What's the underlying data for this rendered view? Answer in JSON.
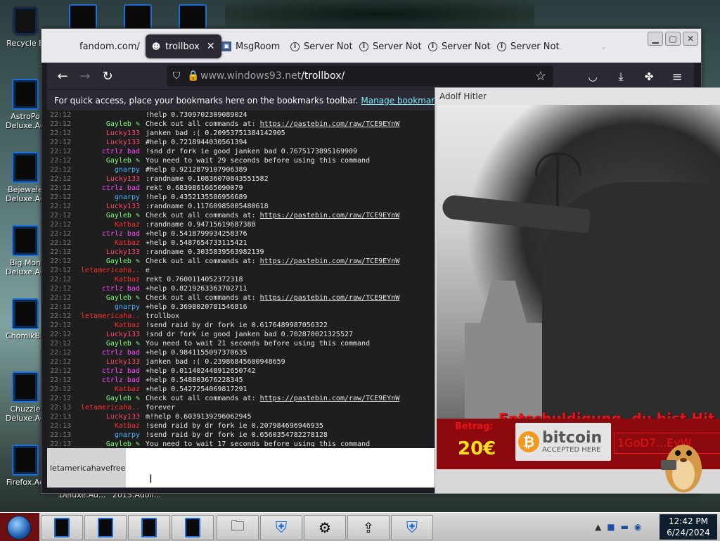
{
  "desktop": {
    "icons": [
      {
        "label": "Recycle B",
        "name": "recycle-bin"
      },
      {
        "label": "AstroPo Deluxe.Ad",
        "name": "astropo"
      },
      {
        "label": "Bejewele Deluxe.Ad",
        "name": "bejeweled"
      },
      {
        "label": "Big Mon Deluxe.Ad",
        "name": "bigmon"
      },
      {
        "label": "ChomikBo",
        "name": "chomikbo"
      },
      {
        "label": "Chuzzle Deluxe.Ad",
        "name": "chuzzle"
      },
      {
        "label": "Firefox.Ad",
        "name": "firefox"
      }
    ],
    "bottom_labels": [
      "Deluxe.Ad...",
      "2015.Adolf..."
    ]
  },
  "browser": {
    "tabs": [
      {
        "label": "fandom.com/",
        "icon": "none",
        "active": false
      },
      {
        "label": "trollbox",
        "icon": "troll-icon",
        "active": true
      },
      {
        "label": "MsgRoom",
        "icon": "msgroom-icon",
        "active": false
      },
      {
        "label": "Server Not",
        "icon": "info-icon",
        "active": false
      },
      {
        "label": "Server Not",
        "icon": "info-icon",
        "active": false
      },
      {
        "label": "Server Not",
        "icon": "info-icon",
        "active": false
      },
      {
        "label": "Server Not",
        "icon": "info-icon",
        "active": false
      }
    ],
    "url_host": "www.windows93.net",
    "url_path": "/trollbox/",
    "bookmarks_text": "For quick access, place your bookmarks here on the bookmarks toolbar.",
    "bookmarks_link": "Manage bookmarks..."
  },
  "chat": {
    "rows": [
      {
        "t": "22:12",
        "n": "",
        "c": "#ff6fd0",
        "m": "!help 0.7309702309089024"
      },
      {
        "t": "22:12",
        "n": "Gayleb ✎",
        "c": "#7cff7c",
        "m": "Check out all commands at: ",
        "link": "https://pastebin.com/raw/TCE9EYnW"
      },
      {
        "t": "22:12",
        "n": "Lucky133",
        "c": "#ff4a6a",
        "m": "janken bad :( 0.20953751384142905"
      },
      {
        "t": "22:12",
        "n": "Lucky133",
        "c": "#ff4a6a",
        "m": "#help 0.7218944030561394"
      },
      {
        "t": "22:12",
        "n": "ctrlz bad",
        "c": "#ff4aff",
        "m": "!snd dr fork ie good janken bad 0.7675173895169909"
      },
      {
        "t": "22:12",
        "n": "Gayleb ✎",
        "c": "#7cff7c",
        "m": "You need to wait 29 seconds before using this command"
      },
      {
        "t": "22:12",
        "n": "gnarpy",
        "c": "#4ab0ff",
        "m": "#help 0.9212879107906389"
      },
      {
        "t": "22:12",
        "n": "Lucky133",
        "c": "#ff4a6a",
        "m": ":randname 0.10836070843551582"
      },
      {
        "t": "22:12",
        "n": "ctrlz bad",
        "c": "#ff4aff",
        "m": "rekt 0.6839861665090079"
      },
      {
        "t": "22:12",
        "n": "gnarpy",
        "c": "#4ab0ff",
        "m": "!help 0.4352135586956689"
      },
      {
        "t": "22:12",
        "n": "Lucky133",
        "c": "#ff4a6a",
        "m": ":randname 0.11760985005480618"
      },
      {
        "t": "22:12",
        "n": "Gayleb ✎",
        "c": "#7cff7c",
        "m": "Check out all commands at: ",
        "link": "https://pastebin.com/raw/TCE9EYnW"
      },
      {
        "t": "22:12",
        "n": "Katbaz",
        "c": "#ff3030",
        "m": ":randname 0.94715619687388"
      },
      {
        "t": "22:12",
        "n": "ctrlz bad",
        "c": "#ff4aff",
        "m": "+help 0.5418799934258376"
      },
      {
        "t": "22:12",
        "n": "Katbaz",
        "c": "#ff3030",
        "m": "+help 0.5487654733115421"
      },
      {
        "t": "22:12",
        "n": "Lucky133",
        "c": "#ff4a6a",
        "m": ":randname 0.3035839563982139"
      },
      {
        "t": "22:12",
        "n": "Gayleb ✎",
        "c": "#7cff7c",
        "m": "Check out all commands at: ",
        "link": "https://pastebin.com/raw/TCE9EYnW"
      },
      {
        "t": "22:12",
        "n": "letamericaha..",
        "c": "#ff3030",
        "m": "e"
      },
      {
        "t": "22:12",
        "n": "Katbaz",
        "c": "#ff3030",
        "m": "rekt 0.7600114052372318"
      },
      {
        "t": "22:12",
        "n": "ctrlz bad",
        "c": "#ff4aff",
        "m": "+help 0.8219263363702711"
      },
      {
        "t": "22:12",
        "n": "Gayleb ✎",
        "c": "#7cff7c",
        "m": "Check out all commands at: ",
        "link": "https://pastebin.com/raw/TCE9EYnW"
      },
      {
        "t": "22:12",
        "n": "gnarpy",
        "c": "#4ab0ff",
        "m": "+help 0.3698020781546816"
      },
      {
        "t": "22:12",
        "n": "letamericaha..",
        "c": "#ff3030",
        "m": "trollbox"
      },
      {
        "t": "22:12",
        "n": "Katbaz",
        "c": "#ff3030",
        "m": "!send raid by dr fork ie 0.6176489987056322"
      },
      {
        "t": "22:12",
        "n": "Lucky133",
        "c": "#ff4a6a",
        "m": "!snd dr fork ie good janken bad 0.702870021325527"
      },
      {
        "t": "22:12",
        "n": "Gayleb ✎",
        "c": "#7cff7c",
        "m": "You need to wait 21 seconds before using this command"
      },
      {
        "t": "22:12",
        "n": "ctrlz bad",
        "c": "#ff4aff",
        "m": "+help 0.9841155097370635"
      },
      {
        "t": "22:12",
        "n": "Lucky133",
        "c": "#ff4a6a",
        "m": "janken bad :( 0.23986845600948659"
      },
      {
        "t": "22:12",
        "n": "ctrlz bad",
        "c": "#ff4aff",
        "m": "+help 0.011402448912650742"
      },
      {
        "t": "22:12",
        "n": "ctrlz bad",
        "c": "#ff4aff",
        "m": "+help 0.548803676228345"
      },
      {
        "t": "22:12",
        "n": "Katbaz",
        "c": "#ff3030",
        "m": "+help 0.5427254069817291"
      },
      {
        "t": "22:12",
        "n": "Gayleb ✎",
        "c": "#7cff7c",
        "m": "Check out all commands at: ",
        "link": "https://pastebin.com/raw/TCE9EYnW"
      },
      {
        "t": "22:13",
        "n": "letamericaha..",
        "c": "#ff3030",
        "m": "forever"
      },
      {
        "t": "22:13",
        "n": "Lucky133",
        "c": "#ff4a6a",
        "m": "m!help 0.6039139296062945"
      },
      {
        "t": "22:13",
        "n": "Katbaz",
        "c": "#ff3030",
        "m": "!send raid by dr fork ie 0.207984696946935"
      },
      {
        "t": "22:13",
        "n": "gnarpy",
        "c": "#4ab0ff",
        "m": "!send raid by dr fork ie 0.6560354782278128"
      },
      {
        "t": "22:13",
        "n": "Gayleb ✎",
        "c": "#7cff7c",
        "m": "You need to wait 17 seconds before using this command"
      }
    ],
    "nick_box": "letamericahavefreedom",
    "input_value": ""
  },
  "popup": {
    "title": "Adolf Hitler",
    "ransom_text": "Entschuldigung, du bist Hit",
    "betrag_label": "Betrag:",
    "price": "20€",
    "bitcoin_word": "bitcoin",
    "bitcoin_sub": "ACCEPTED HERE",
    "wallet": "1GoD7...EyW"
  },
  "taskbar": {
    "clock_time": "12:42 PM",
    "clock_date": "6/24/2024"
  },
  "colors": {
    "chat_bg": "#1e1e1e",
    "ransom_red": "#e8121a",
    "price_yellow": "#ffe01a",
    "firefox_dark": "#2b2a33"
  }
}
